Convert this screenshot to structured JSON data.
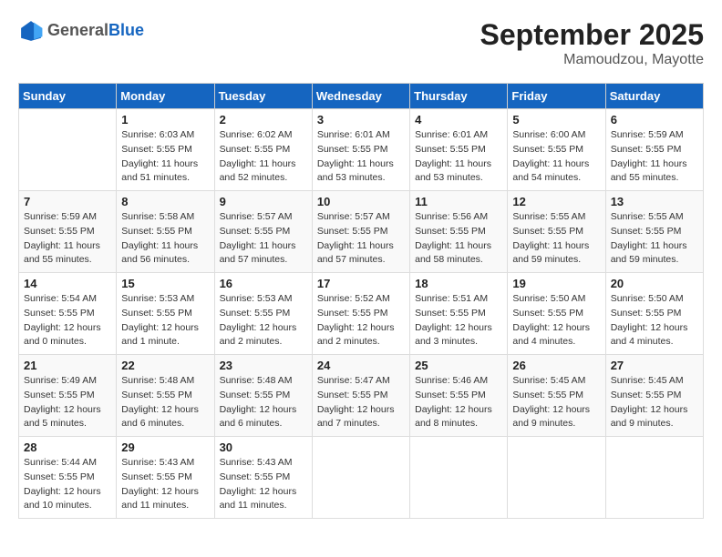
{
  "header": {
    "logo_general": "General",
    "logo_blue": "Blue",
    "month": "September 2025",
    "location": "Mamoudzou, Mayotte"
  },
  "days_of_week": [
    "Sunday",
    "Monday",
    "Tuesday",
    "Wednesday",
    "Thursday",
    "Friday",
    "Saturday"
  ],
  "weeks": [
    [
      {
        "day": "",
        "info": ""
      },
      {
        "day": "1",
        "info": "Sunrise: 6:03 AM\nSunset: 5:55 PM\nDaylight: 11 hours\nand 51 minutes."
      },
      {
        "day": "2",
        "info": "Sunrise: 6:02 AM\nSunset: 5:55 PM\nDaylight: 11 hours\nand 52 minutes."
      },
      {
        "day": "3",
        "info": "Sunrise: 6:01 AM\nSunset: 5:55 PM\nDaylight: 11 hours\nand 53 minutes."
      },
      {
        "day": "4",
        "info": "Sunrise: 6:01 AM\nSunset: 5:55 PM\nDaylight: 11 hours\nand 53 minutes."
      },
      {
        "day": "5",
        "info": "Sunrise: 6:00 AM\nSunset: 5:55 PM\nDaylight: 11 hours\nand 54 minutes."
      },
      {
        "day": "6",
        "info": "Sunrise: 5:59 AM\nSunset: 5:55 PM\nDaylight: 11 hours\nand 55 minutes."
      }
    ],
    [
      {
        "day": "7",
        "info": "Sunrise: 5:59 AM\nSunset: 5:55 PM\nDaylight: 11 hours\nand 55 minutes."
      },
      {
        "day": "8",
        "info": "Sunrise: 5:58 AM\nSunset: 5:55 PM\nDaylight: 11 hours\nand 56 minutes."
      },
      {
        "day": "9",
        "info": "Sunrise: 5:57 AM\nSunset: 5:55 PM\nDaylight: 11 hours\nand 57 minutes."
      },
      {
        "day": "10",
        "info": "Sunrise: 5:57 AM\nSunset: 5:55 PM\nDaylight: 11 hours\nand 57 minutes."
      },
      {
        "day": "11",
        "info": "Sunrise: 5:56 AM\nSunset: 5:55 PM\nDaylight: 11 hours\nand 58 minutes."
      },
      {
        "day": "12",
        "info": "Sunrise: 5:55 AM\nSunset: 5:55 PM\nDaylight: 11 hours\nand 59 minutes."
      },
      {
        "day": "13",
        "info": "Sunrise: 5:55 AM\nSunset: 5:55 PM\nDaylight: 11 hours\nand 59 minutes."
      }
    ],
    [
      {
        "day": "14",
        "info": "Sunrise: 5:54 AM\nSunset: 5:55 PM\nDaylight: 12 hours\nand 0 minutes."
      },
      {
        "day": "15",
        "info": "Sunrise: 5:53 AM\nSunset: 5:55 PM\nDaylight: 12 hours\nand 1 minute."
      },
      {
        "day": "16",
        "info": "Sunrise: 5:53 AM\nSunset: 5:55 PM\nDaylight: 12 hours\nand 2 minutes."
      },
      {
        "day": "17",
        "info": "Sunrise: 5:52 AM\nSunset: 5:55 PM\nDaylight: 12 hours\nand 2 minutes."
      },
      {
        "day": "18",
        "info": "Sunrise: 5:51 AM\nSunset: 5:55 PM\nDaylight: 12 hours\nand 3 minutes."
      },
      {
        "day": "19",
        "info": "Sunrise: 5:50 AM\nSunset: 5:55 PM\nDaylight: 12 hours\nand 4 minutes."
      },
      {
        "day": "20",
        "info": "Sunrise: 5:50 AM\nSunset: 5:55 PM\nDaylight: 12 hours\nand 4 minutes."
      }
    ],
    [
      {
        "day": "21",
        "info": "Sunrise: 5:49 AM\nSunset: 5:55 PM\nDaylight: 12 hours\nand 5 minutes."
      },
      {
        "day": "22",
        "info": "Sunrise: 5:48 AM\nSunset: 5:55 PM\nDaylight: 12 hours\nand 6 minutes."
      },
      {
        "day": "23",
        "info": "Sunrise: 5:48 AM\nSunset: 5:55 PM\nDaylight: 12 hours\nand 6 minutes."
      },
      {
        "day": "24",
        "info": "Sunrise: 5:47 AM\nSunset: 5:55 PM\nDaylight: 12 hours\nand 7 minutes."
      },
      {
        "day": "25",
        "info": "Sunrise: 5:46 AM\nSunset: 5:55 PM\nDaylight: 12 hours\nand 8 minutes."
      },
      {
        "day": "26",
        "info": "Sunrise: 5:45 AM\nSunset: 5:55 PM\nDaylight: 12 hours\nand 9 minutes."
      },
      {
        "day": "27",
        "info": "Sunrise: 5:45 AM\nSunset: 5:55 PM\nDaylight: 12 hours\nand 9 minutes."
      }
    ],
    [
      {
        "day": "28",
        "info": "Sunrise: 5:44 AM\nSunset: 5:55 PM\nDaylight: 12 hours\nand 10 minutes."
      },
      {
        "day": "29",
        "info": "Sunrise: 5:43 AM\nSunset: 5:55 PM\nDaylight: 12 hours\nand 11 minutes."
      },
      {
        "day": "30",
        "info": "Sunrise: 5:43 AM\nSunset: 5:55 PM\nDaylight: 12 hours\nand 11 minutes."
      },
      {
        "day": "",
        "info": ""
      },
      {
        "day": "",
        "info": ""
      },
      {
        "day": "",
        "info": ""
      },
      {
        "day": "",
        "info": ""
      }
    ]
  ]
}
